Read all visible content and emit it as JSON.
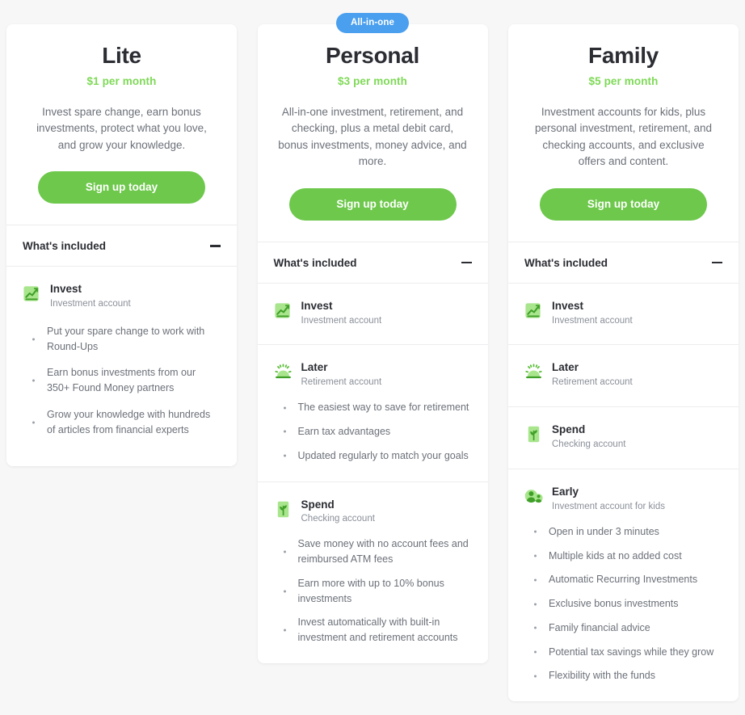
{
  "colors": {
    "background": "#f7f7f7",
    "card": "#ffffff",
    "accent_green": "#6dc84b",
    "price_green": "#7ed957",
    "badge_blue": "#4a9fee",
    "heading": "#2b2d33",
    "body_text": "#6b7078",
    "muted_text": "#8a8f98",
    "divider": "#ededef"
  },
  "plans": [
    {
      "id": "lite",
      "name": "Lite",
      "price": "$1 per month",
      "description": "Invest spare change, earn bonus investments, protect what you love, and grow your knowledge.",
      "cta_label": "Sign up today",
      "badge": null,
      "included_label": "What's included",
      "toggle_icon": "minus-icon",
      "features": [
        {
          "icon": "invest-chart-icon",
          "title": "Invest",
          "subtitle": "Investment account",
          "bullets": [
            "Put your spare change to work with Round-Ups",
            "Earn bonus investments from our 350+ Found Money partners",
            "Grow your knowledge with hundreds of articles from financial experts"
          ]
        }
      ]
    },
    {
      "id": "personal",
      "name": "Personal",
      "price": "$3 per month",
      "description": "All-in-one investment, retirement, and checking, plus a metal debit card, bonus investments, money advice, and more.",
      "cta_label": "Sign up today",
      "badge": "All-in-one",
      "included_label": "What's included",
      "toggle_icon": "minus-icon",
      "features": [
        {
          "icon": "invest-chart-icon",
          "title": "Invest",
          "subtitle": "Investment account",
          "bullets": []
        },
        {
          "icon": "later-sunrise-icon",
          "title": "Later",
          "subtitle": "Retirement account",
          "bullets": [
            "The easiest way to save for retirement",
            "Earn tax advantages",
            "Updated regularly to match your goals"
          ]
        },
        {
          "icon": "spend-card-icon",
          "title": "Spend",
          "subtitle": "Checking account",
          "bullets": [
            "Save money with no account fees and reimbursed ATM fees",
            "Earn more with up to 10% bonus investments",
            "Invest automatically with built-in investment and retirement accounts"
          ]
        }
      ]
    },
    {
      "id": "family",
      "name": "Family",
      "price": "$5 per month",
      "description": "Investment accounts for kids, plus personal investment, retirement, and checking accounts, and exclusive offers and content.",
      "cta_label": "Sign up today",
      "badge": null,
      "included_label": "What's included",
      "toggle_icon": "minus-icon",
      "features": [
        {
          "icon": "invest-chart-icon",
          "title": "Invest",
          "subtitle": "Investment account",
          "bullets": []
        },
        {
          "icon": "later-sunrise-icon",
          "title": "Later",
          "subtitle": "Retirement account",
          "bullets": []
        },
        {
          "icon": "spend-card-icon",
          "title": "Spend",
          "subtitle": "Checking account",
          "bullets": []
        },
        {
          "icon": "early-people-icon",
          "title": "Early",
          "subtitle": "Investment account for kids",
          "bullets": [
            "Open in under 3 minutes",
            "Multiple kids at no added cost",
            "Automatic Recurring Investments",
            "Exclusive bonus investments",
            "Family financial advice",
            "Potential tax savings while they grow",
            "Flexibility with the funds"
          ]
        }
      ]
    }
  ]
}
